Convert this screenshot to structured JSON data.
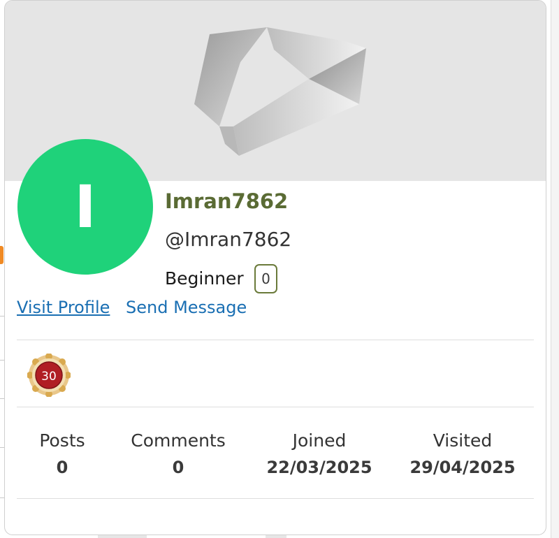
{
  "profile": {
    "avatar_letter": "I",
    "avatar_color": "#1fd27a",
    "display_name": "Imran7862",
    "handle": "@Imran7862",
    "rank": "Beginner",
    "rank_count": "0"
  },
  "actions": {
    "visit_profile": "Visit Profile",
    "send_message": "Send Message"
  },
  "badges": [
    {
      "icon": "anniversary-badge-icon",
      "label": "30"
    }
  ],
  "stats": [
    {
      "label": "Posts",
      "value": "0"
    },
    {
      "label": "Comments",
      "value": "0"
    },
    {
      "label": "Joined",
      "value": "22/03/2025"
    },
    {
      "label": "Visited",
      "value": "29/04/2025"
    }
  ],
  "colors": {
    "name_color": "#5a6b34",
    "link_color": "#1a6fb3",
    "cover_bg": "#e5e5e5"
  }
}
